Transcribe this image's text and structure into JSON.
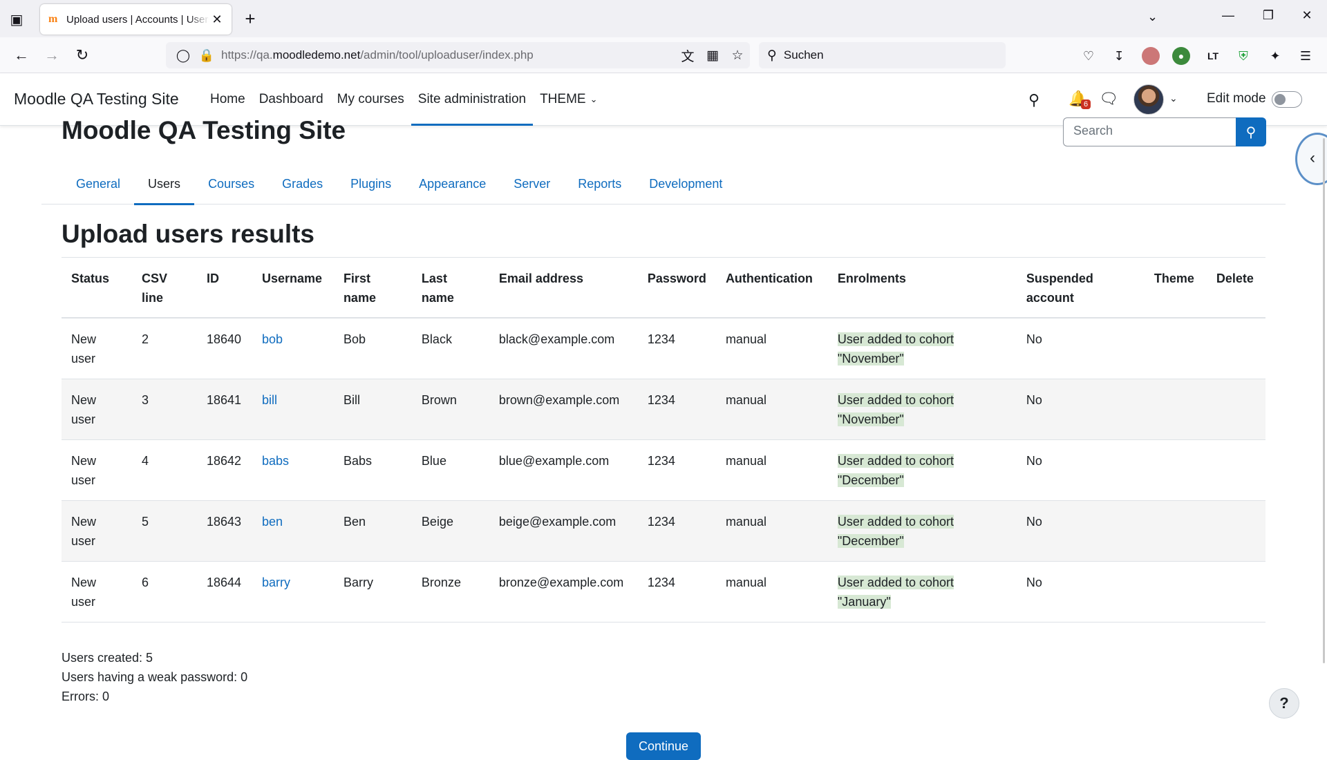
{
  "browser": {
    "tab_title": "Upload users | Accounts | Users",
    "url_prefix": "https://qa.",
    "url_domain": "moodledemo.net",
    "url_path": "/admin/tool/uploaduser/index.php",
    "search_placeholder": "Suchen"
  },
  "site": {
    "brand": "Moodle QA Testing Site",
    "heading": "Moodle QA Testing Site",
    "nav": [
      {
        "label": "Home"
      },
      {
        "label": "Dashboard"
      },
      {
        "label": "My courses"
      },
      {
        "label": "Site administration",
        "active": true
      },
      {
        "label": "THEME",
        "dropdown": true
      }
    ],
    "notification_count": "6",
    "edit_mode_label": "Edit mode",
    "search_placeholder": "Search"
  },
  "secondary_nav": [
    {
      "label": "General"
    },
    {
      "label": "Users",
      "active": true
    },
    {
      "label": "Courses"
    },
    {
      "label": "Grades"
    },
    {
      "label": "Plugins"
    },
    {
      "label": "Appearance"
    },
    {
      "label": "Server"
    },
    {
      "label": "Reports"
    },
    {
      "label": "Development"
    }
  ],
  "results": {
    "title": "Upload users results",
    "columns": [
      "Status",
      "CSV line",
      "ID",
      "Username",
      "First name",
      "Last name",
      "Email address",
      "Password",
      "Authentication",
      "Enrolments",
      "Suspended account",
      "Theme",
      "Delete"
    ],
    "rows": [
      {
        "status": "New user",
        "csv_line": "2",
        "id": "18640",
        "username": "bob",
        "first": "Bob",
        "last": "Black",
        "email": "black@example.com",
        "password": "1234",
        "auth": "manual",
        "enrolments": "User added to cohort \"November\"",
        "suspended": "No",
        "theme": "",
        "delete": ""
      },
      {
        "status": "New user",
        "csv_line": "3",
        "id": "18641",
        "username": "bill",
        "first": "Bill",
        "last": "Brown",
        "email": "brown@example.com",
        "password": "1234",
        "auth": "manual",
        "enrolments": "User added to cohort \"November\"",
        "suspended": "No",
        "theme": "",
        "delete": ""
      },
      {
        "status": "New user",
        "csv_line": "4",
        "id": "18642",
        "username": "babs",
        "first": "Babs",
        "last": "Blue",
        "email": "blue@example.com",
        "password": "1234",
        "auth": "manual",
        "enrolments": "User added to cohort \"December\"",
        "suspended": "No",
        "theme": "",
        "delete": ""
      },
      {
        "status": "New user",
        "csv_line": "5",
        "id": "18643",
        "username": "ben",
        "first": "Ben",
        "last": "Beige",
        "email": "beige@example.com",
        "password": "1234",
        "auth": "manual",
        "enrolments": "User added to cohort \"December\"",
        "suspended": "No",
        "theme": "",
        "delete": ""
      },
      {
        "status": "New user",
        "csv_line": "6",
        "id": "18644",
        "username": "barry",
        "first": "Barry",
        "last": "Bronze",
        "email": "bronze@example.com",
        "password": "1234",
        "auth": "manual",
        "enrolments": "User added to cohort \"January\"",
        "suspended": "No",
        "theme": "",
        "delete": ""
      }
    ]
  },
  "summary": {
    "created": "Users created: 5",
    "weak": "Users having a weak password: 0",
    "errors": "Errors: 0"
  },
  "continue_label": "Continue",
  "help_label": "?",
  "colors": {
    "accent": "#0f6cbf",
    "enrol_highlight": "#d7e8d4",
    "badge": "#ca3120"
  }
}
